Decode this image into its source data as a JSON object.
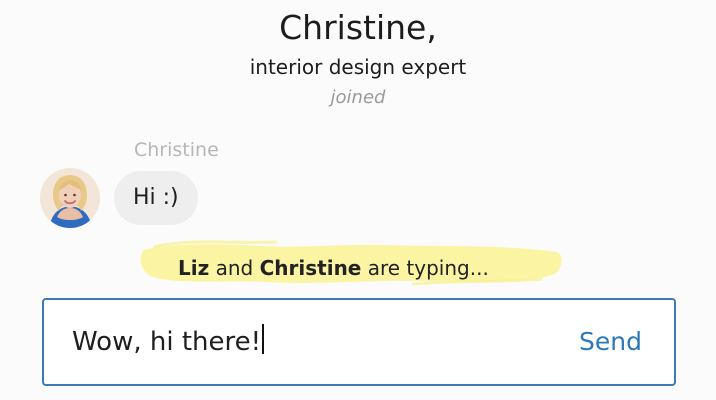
{
  "header": {
    "name": "Christine,",
    "role": "interior design expert",
    "status": "joined"
  },
  "message": {
    "sender": "Christine",
    "text": "Hi :)",
    "avatar_icon": "person-avatar"
  },
  "typing": {
    "name1": "Liz",
    "conjunction": "and",
    "name2": "Christine",
    "suffix": "are typing...",
    "highlight_color": "#fbf5a3"
  },
  "composer": {
    "value": "Wow, hi there!",
    "send_label": "Send",
    "accent_color": "#3a7ab8"
  }
}
